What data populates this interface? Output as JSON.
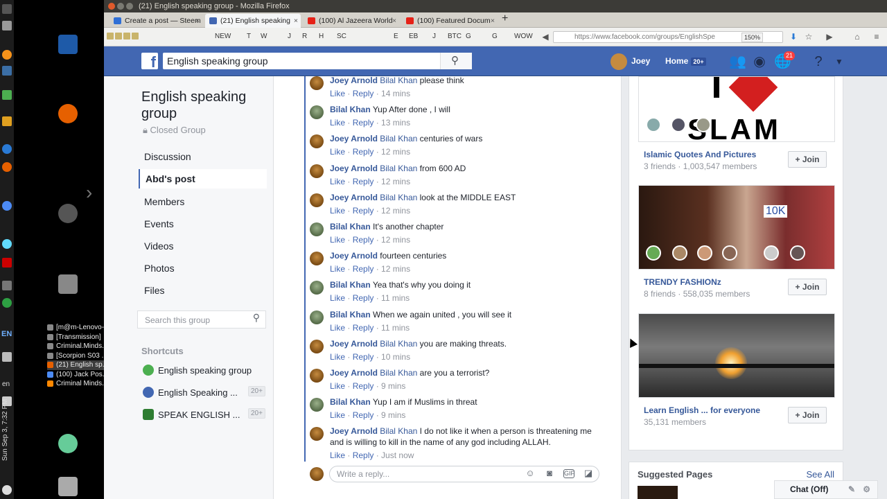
{
  "window": {
    "title": "(21) English speaking group - Mozilla Firefox"
  },
  "tabs": [
    {
      "label": "Create a post — Steem"
    },
    {
      "label": "(21) English speaking"
    },
    {
      "label": "(100) Al Jazeera World"
    },
    {
      "label": "(100) Featured Docum"
    }
  ],
  "bookmarks": [
    "NEW",
    "T",
    "W",
    "J",
    "R",
    "H",
    "SC",
    "E",
    "EB",
    "J",
    "BTC",
    "G",
    "G",
    "WOW"
  ],
  "browser": {
    "url": "https://www.facebook.com/groups/EnglishSpe",
    "zoom": "150%"
  },
  "fb": {
    "search_value": "English speaking group",
    "user_name": "Joey",
    "home_label": "Home",
    "home_badge": "20+",
    "notif_count": "21"
  },
  "group": {
    "title": "English speaking group",
    "type": "Closed Group"
  },
  "left_nav": [
    "Discussion",
    "Abd's post",
    "Members",
    "Events",
    "Videos",
    "Photos",
    "Files"
  ],
  "left_search_placeholder": "Search this group",
  "shortcuts": {
    "title": "Shortcuts",
    "items": [
      {
        "label": "English speaking group",
        "badge": "",
        "color": "#4caf50"
      },
      {
        "label": "English Speaking ...",
        "badge": "20+",
        "color": "#4267b2"
      },
      {
        "label": "SPEAK ENGLISH ...",
        "badge": "20+",
        "color": "#2e7d32"
      }
    ]
  },
  "comments": [
    {
      "author": "Joey Arnold",
      "tag": "Bilal Khan",
      "text": "please think",
      "time": "14 mins",
      "who": "joey"
    },
    {
      "author": "Bilal Khan",
      "tag": "",
      "text": "Yup After done , I will",
      "time": "13 mins",
      "who": "bilal"
    },
    {
      "author": "Joey Arnold",
      "tag": "Bilal Khan",
      "text": "centuries of wars",
      "time": "12 mins",
      "who": "joey"
    },
    {
      "author": "Joey Arnold",
      "tag": "Bilal Khan",
      "text": "from 600 AD",
      "time": "12 mins",
      "who": "joey"
    },
    {
      "author": "Joey Arnold",
      "tag": "Bilal Khan",
      "text": "look at the MIDDLE EAST",
      "time": "12 mins",
      "who": "joey"
    },
    {
      "author": "Bilal Khan",
      "tag": "",
      "text": "It's another chapter",
      "time": "12 mins",
      "who": "bilal"
    },
    {
      "author": "Joey Arnold",
      "tag": "",
      "text": "fourteen centuries",
      "time": "12 mins",
      "who": "joey"
    },
    {
      "author": "Bilal Khan",
      "tag": "",
      "text": "Yea that's why you doing it",
      "time": "11 mins",
      "who": "bilal"
    },
    {
      "author": "Bilal Khan",
      "tag": "",
      "text": "When we again united , you will see it",
      "time": "11 mins",
      "who": "bilal"
    },
    {
      "author": "Joey Arnold",
      "tag": "Bilal Khan",
      "text": "you are making threats.",
      "time": "10 mins",
      "who": "joey"
    },
    {
      "author": "Joey Arnold",
      "tag": "Bilal Khan",
      "text": "are you a terrorist?",
      "time": "9 mins",
      "who": "joey"
    },
    {
      "author": "Bilal Khan",
      "tag": "",
      "text": "Yup I am if Muslims in threat",
      "time": "9 mins",
      "who": "bilal"
    },
    {
      "author": "Joey Arnold",
      "tag": "Bilal Khan",
      "text": "I do not like it when a person is threatening me and is willing to kill in the name of any god including ALLAH.",
      "time": "Just now",
      "who": "joey"
    }
  ],
  "comment_actions": {
    "like": "Like",
    "reply": "Reply"
  },
  "reply_placeholder": "Write a reply...",
  "suggestions": [
    {
      "name": "Islamic Quotes And Pictures",
      "meta": "3 friends · 1,003,547 members",
      "join": "Join"
    },
    {
      "name": "TRENDY FASHIONz",
      "meta": "8 friends · 558,035 members",
      "join": "Join"
    },
    {
      "name": "Learn English ... for everyone",
      "meta": "35,131 members",
      "join": "Join"
    }
  ],
  "suggestion_image_text": {
    "islam": "SLAM",
    "trendy_badge": "10K"
  },
  "suggested_pages": {
    "title": "Suggested Pages",
    "see_all": "See All"
  },
  "chat": {
    "label": "Chat (Off)"
  },
  "desktop": {
    "taskbar_items": [
      "[m@m-Lenovo-...",
      "[Transmission]",
      "Criminal.Minds...",
      "[Scorpion S03 ...",
      "(21) English sp...",
      "(100) Jack Pos...",
      "Criminal Minds..."
    ],
    "lang": "EN",
    "lang2": "en",
    "clock": "Sun Sep 3, 7:32 PM"
  }
}
